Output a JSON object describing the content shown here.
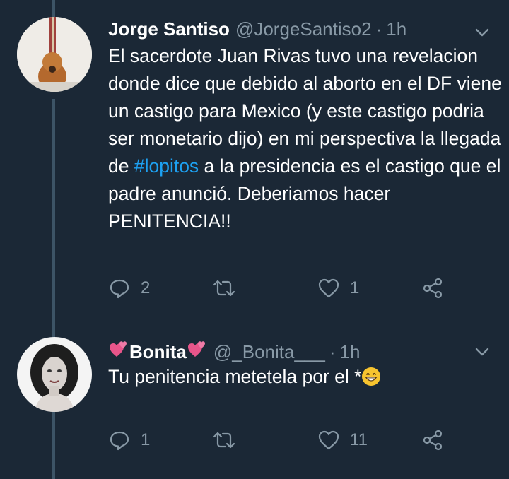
{
  "tweets": [
    {
      "name": "Jorge Santiso",
      "handle": "@JorgeSantiso2",
      "separator": "·",
      "time": "1h",
      "text_before": "El sacerdote Juan Rivas tuvo una revelacion donde dice que debido al aborto en el DF viene un castigo para Mexico (y este castigo podria ser monetario dijo) en mi perspectiva la llegada de ",
      "hashtag": "#lopitos",
      "text_after": " a la presidencia es el castigo que el padre anunció. Deberiamos hacer PENITENCIA!!",
      "replies": "2",
      "retweets": "",
      "likes": "1"
    },
    {
      "name": "Bonita",
      "handle": "@_Bonita___",
      "separator": "·",
      "time": "1h",
      "text": "Tu penitencia metetela por el *",
      "replies": "1",
      "retweets": "",
      "likes": "11"
    }
  ],
  "icons": {
    "reply": "reply-icon",
    "retweet": "retweet-icon",
    "like": "heart-icon",
    "share": "share-icon",
    "more": "chevron-down-icon"
  },
  "colors": {
    "background": "#1b2836",
    "secondary_text": "#8899a6",
    "link": "#1da1f2",
    "thread_line": "#3d5466"
  }
}
